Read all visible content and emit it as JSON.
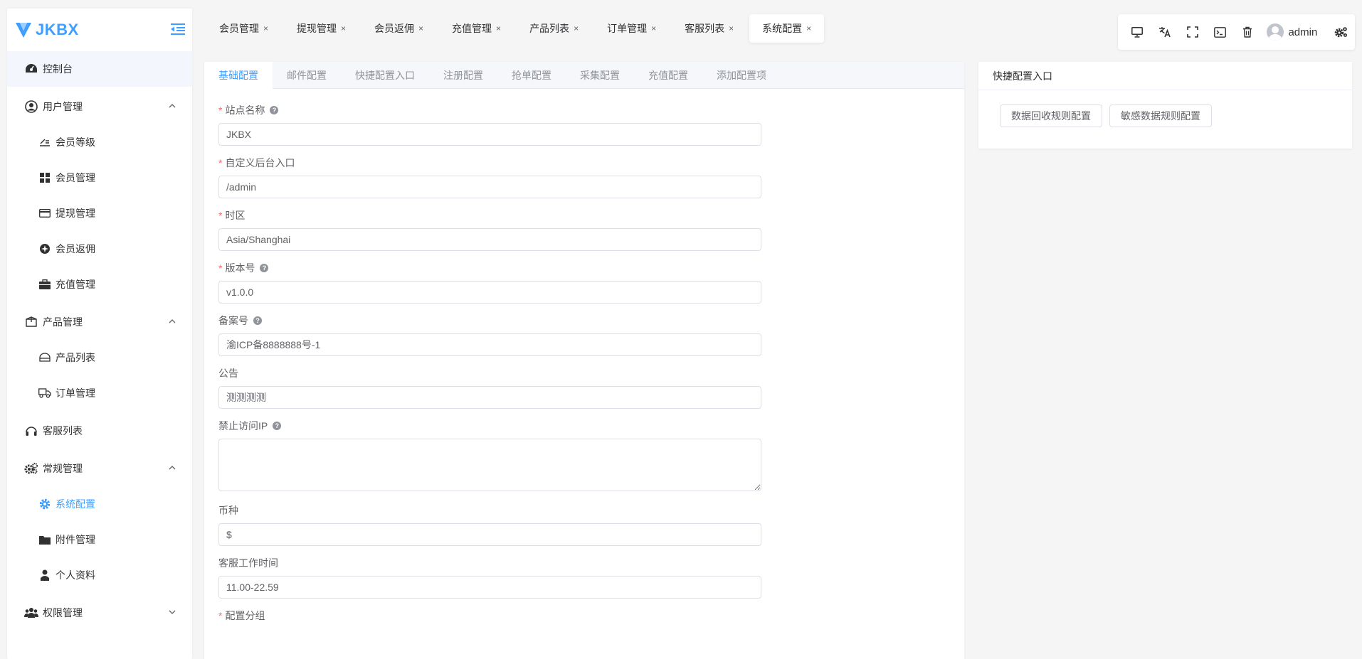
{
  "app": {
    "name": "JKBX",
    "colors": {
      "accent": "#409eff",
      "required": "#f56c6c",
      "text": "#303133",
      "muted": "#909399"
    }
  },
  "sidebar": {
    "home": {
      "label": "控制台",
      "icon": "dashboard-icon"
    },
    "groups": [
      {
        "label": "用户管理",
        "icon": "user-circle-icon",
        "expanded": true,
        "items": [
          {
            "label": "会员等级",
            "icon": "level-icon"
          },
          {
            "label": "会员管理",
            "icon": "grid-icon"
          },
          {
            "label": "提现管理",
            "icon": "card-icon"
          },
          {
            "label": "会员返佣",
            "icon": "commission-icon"
          },
          {
            "label": "充值管理",
            "icon": "briefcase-icon"
          }
        ]
      },
      {
        "label": "产品管理",
        "icon": "box-icon",
        "expanded": true,
        "items": [
          {
            "label": "产品列表",
            "icon": "product-list-icon"
          },
          {
            "label": "订单管理",
            "icon": "truck-icon"
          }
        ]
      },
      {
        "label": "客服列表",
        "icon": "headset-icon"
      },
      {
        "label": "常规管理",
        "icon": "gears-icon",
        "expanded": true,
        "items": [
          {
            "label": "系统配置",
            "icon": "gear-icon",
            "active": true
          },
          {
            "label": "附件管理",
            "icon": "folder-icon"
          },
          {
            "label": "个人资料",
            "icon": "person-icon"
          }
        ]
      },
      {
        "label": "权限管理",
        "icon": "users-icon",
        "expanded": false
      }
    ]
  },
  "nav_tabs": [
    {
      "label": "会员管理"
    },
    {
      "label": "提现管理"
    },
    {
      "label": "会员返佣"
    },
    {
      "label": "充值管理"
    },
    {
      "label": "产品列表"
    },
    {
      "label": "订单管理"
    },
    {
      "label": "客服列表"
    },
    {
      "label": "系统配置",
      "active": true
    }
  ],
  "close_glyph": "×",
  "toolbar": {
    "buttons": [
      "monitor-icon",
      "translate-icon",
      "fullscreen-icon",
      "terminal-icon",
      "trash-icon"
    ],
    "username": "admin",
    "settings_icon": "settings-icon"
  },
  "config_tabs": [
    {
      "label": "基础配置",
      "active": true
    },
    {
      "label": "邮件配置"
    },
    {
      "label": "快捷配置入口"
    },
    {
      "label": "注册配置"
    },
    {
      "label": "抢单配置"
    },
    {
      "label": "采集配置"
    },
    {
      "label": "充值配置"
    },
    {
      "label": "添加配置项"
    }
  ],
  "form": {
    "site_name": {
      "label": "站点名称",
      "value": "JKBX",
      "required": true,
      "help": true
    },
    "admin_entry": {
      "label": "自定义后台入口",
      "value": "/admin",
      "required": true
    },
    "timezone": {
      "label": "时区",
      "value": "Asia/Shanghai",
      "required": true
    },
    "version": {
      "label": "版本号",
      "value": "v1.0.0",
      "required": true,
      "help": true
    },
    "icp": {
      "label": "备案号",
      "value": "渝ICP备8888888号-1",
      "help": true
    },
    "notice": {
      "label": "公告",
      "value": "测测测测"
    },
    "banned_ip": {
      "label": "禁止访问IP",
      "value": "",
      "help": true
    },
    "currency": {
      "label": "币种",
      "value": "$"
    },
    "service_hours": {
      "label": "客服工作时间",
      "value": "11.00-22.59"
    },
    "config_group": {
      "label": "配置分组",
      "required": true
    }
  },
  "help_glyph": "?",
  "required_mark": "*",
  "quick": {
    "title": "快捷配置入口",
    "buttons": [
      "数据回收规则配置",
      "敏感数据规则配置"
    ]
  }
}
